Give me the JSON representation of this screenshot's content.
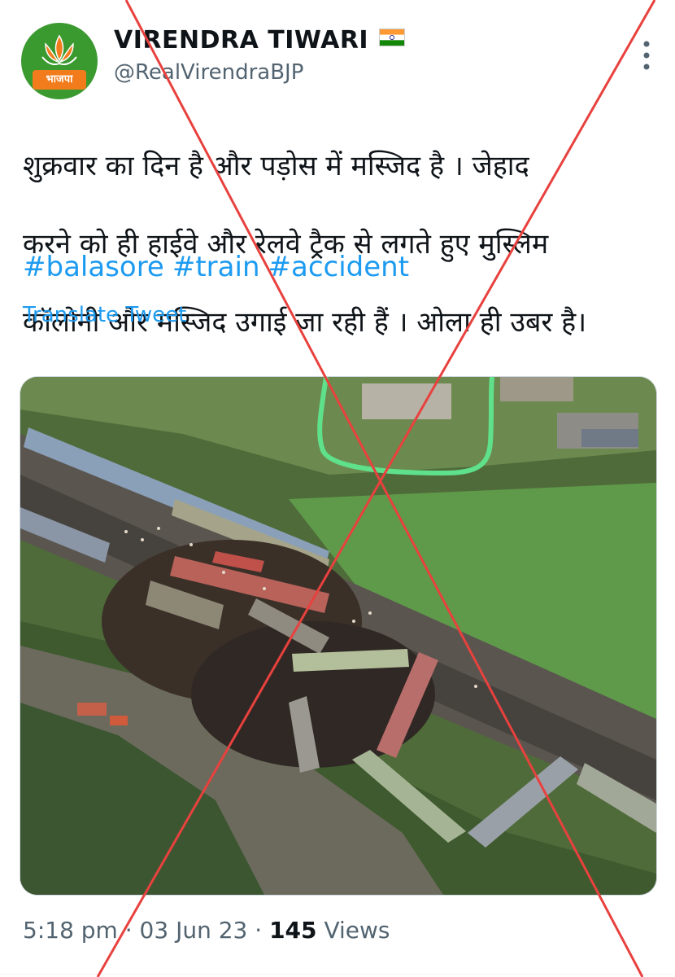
{
  "author": {
    "name": "VIRENDRA TIWARI",
    "handle": "@RealVirendraBJP",
    "avatar_badge": "भाजपा",
    "avatar_icon": "lotus-icon",
    "flag_icon": "india-flag-icon"
  },
  "tweet": {
    "lines": [
      "शुक्रवार का दिन है और पड़ोस में मस्जिद है । जेहाद",
      "करने को ही हाईवे और रेलवे ट्रैक से लगते हुए मुस्लिम",
      "कॉलोनी और मस्जिद उगाई जा रही हैं । ओला ही उबर है।"
    ],
    "hashtags": [
      "#balasore",
      "#train",
      "#accident"
    ],
    "translate_label": "Translate Tweet"
  },
  "media": {
    "alt_icon": "aerial-train-accident-photo"
  },
  "meta": {
    "time": "5:18 pm",
    "separator": "·",
    "date": "03 Jun 23",
    "views_count": "145",
    "views_label": "Views"
  },
  "colors": {
    "link": "#1d9bf0",
    "secondary_text": "#536471",
    "overlay_cross": "#e8413e",
    "highlight": "#5fe08a",
    "party_green": "#3b9a2f",
    "party_saffron": "#f27c1b"
  }
}
